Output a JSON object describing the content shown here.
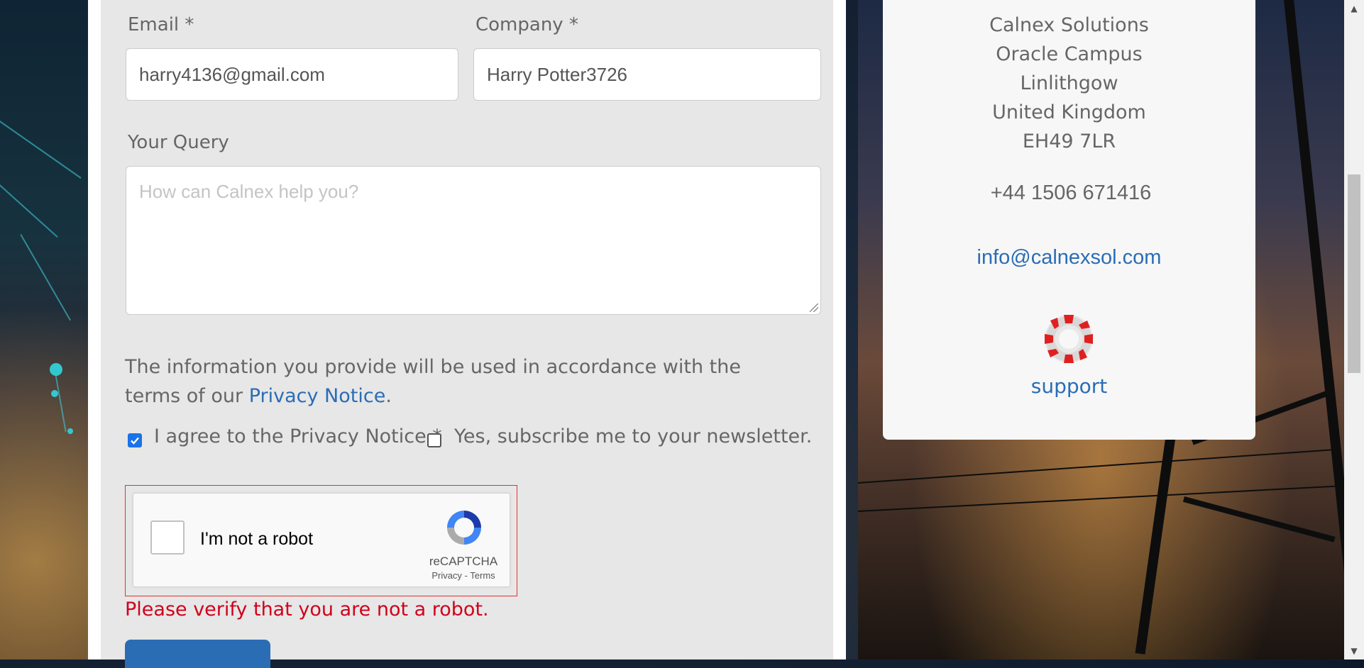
{
  "form": {
    "email": {
      "label": "Email *",
      "value": "harry4136@gmail.com"
    },
    "company": {
      "label": "Company *",
      "value": "Harry Potter3726"
    },
    "query": {
      "label": "Your Query",
      "placeholder": "How can Calnex help you?",
      "value": ""
    },
    "notice": {
      "text_before": "The information you provide will be used in accordance with the terms of our ",
      "link": "Privacy Notice",
      "text_after": "."
    },
    "agree": {
      "label": "I agree to the Privacy Notice *",
      "checked": true
    },
    "newsletter": {
      "label": "Yes, subscribe me to your newsletter.",
      "checked": false
    },
    "captcha": {
      "label": "I'm not a robot",
      "brand": "reCAPTCHA",
      "privacy": "Privacy",
      "separator": "-",
      "terms": "Terms",
      "checked": false
    },
    "error": "Please verify that you are not a robot."
  },
  "contact": {
    "address": [
      "Calnex Solutions",
      "Oracle Campus",
      "Linlithgow",
      "United Kingdom",
      "EH49 7LR"
    ],
    "phone": "+44 1506 671416",
    "email": "info@calnexsol.com",
    "support_label": "support",
    "support_icon": "lifebuoy-icon"
  },
  "colors": {
    "link": "#2a6db5",
    "error": "#d0021b",
    "checkbox_checked": "#1a73e8",
    "captcha_border": "#e53030"
  }
}
